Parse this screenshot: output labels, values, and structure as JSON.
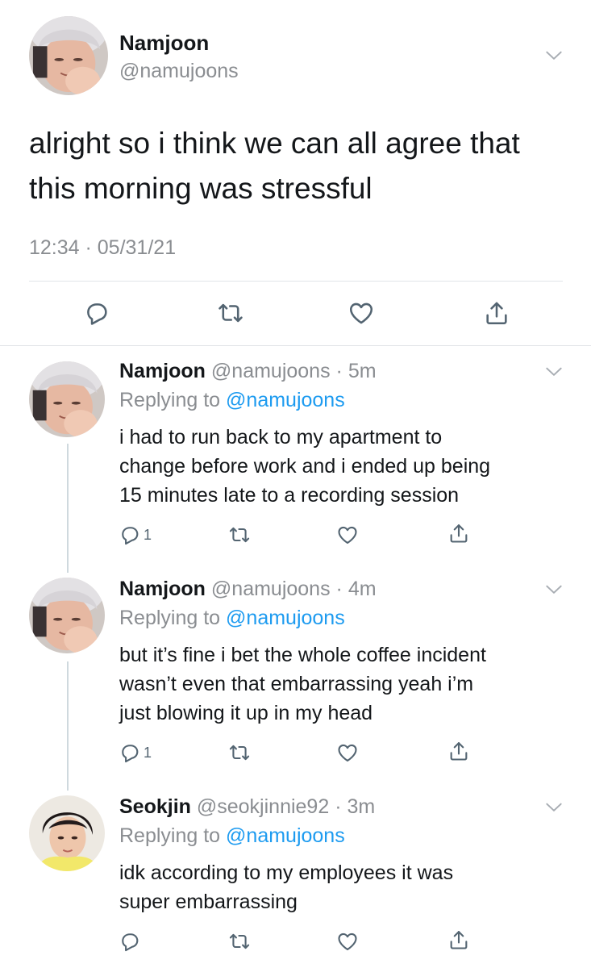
{
  "main_tweet": {
    "name": "Namjoon",
    "handle": "@namujoons",
    "text_lines": [
      "alright so i think we can all agree that",
      "this morning was stressful"
    ],
    "timestamp": "12:34 · 05/31/21"
  },
  "replies": [
    {
      "name": "Namjoon",
      "handle": "@namujoons",
      "time": "· 5m",
      "replying_label": "Replying to",
      "replying_handle": "@namujoons",
      "text_lines": [
        "i had to run back to my apartment to",
        "change before work and i ended up being",
        "15 minutes late to a recording session"
      ],
      "reply_count": "1"
    },
    {
      "name": "Namjoon",
      "handle": "@namujoons",
      "time": "· 4m",
      "replying_label": "Replying to",
      "replying_handle": "@namujoons",
      "text_lines": [
        "but it’s fine i bet the whole coffee incident",
        "wasn’t even that embarrassing yeah i’m",
        "just blowing it up in my head"
      ],
      "reply_count": "1"
    },
    {
      "name": "Seokjin",
      "handle": "@seokjinnie92",
      "time": "· 3m",
      "replying_label": "Replying to",
      "replying_handle": "@namujoons",
      "text_lines": [
        "idk according to my employees it was",
        "super embarrassing"
      ],
      "reply_count": ""
    }
  ],
  "icons": [
    "chevron-down-icon",
    "reply-icon",
    "retweet-icon",
    "like-icon",
    "share-icon"
  ],
  "colors": {
    "link": "#1d9bf0",
    "muted": "#8a8d91",
    "icon": "#536471"
  }
}
